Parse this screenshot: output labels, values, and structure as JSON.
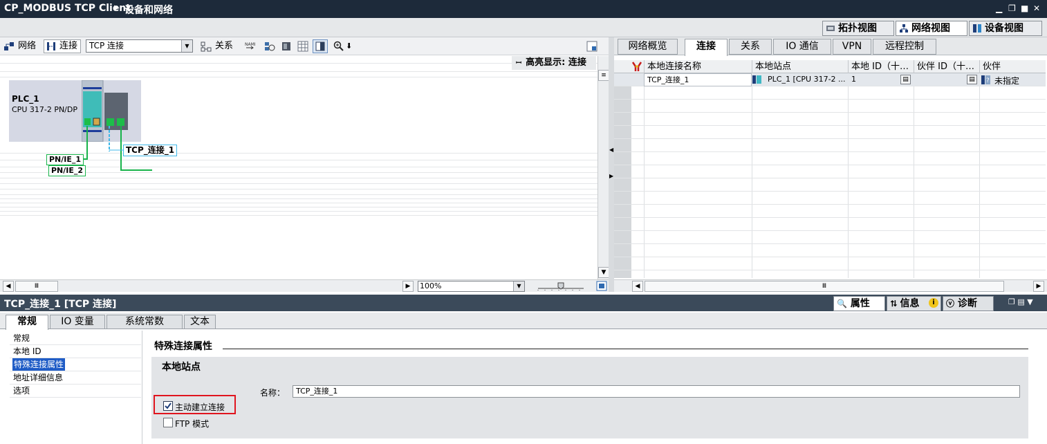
{
  "titlebar": {
    "title": "CP_MODBUS TCP Client",
    "breadcrumb": "设备和网络",
    "win_min": "▁",
    "win_restore": "❐",
    "win_close": "✕"
  },
  "views": {
    "topology": "拓扑视图",
    "network": "网络视图",
    "device": "设备视图"
  },
  "toolbar": {
    "network": "网络",
    "connections": "连接",
    "conn_type": "TCP 连接",
    "relations": "关系"
  },
  "canvas": {
    "highlight": "高亮显示: 连接",
    "plc_name": "PLC_1",
    "plc_cpu": "CPU 317-2 PN/DP",
    "tcp_label": "TCP_连接_1",
    "net1": "PN/IE_1",
    "net2": "PN/IE_2",
    "zoom": "100%",
    "scroll_grip": "Ⅲ"
  },
  "right_tabs": [
    "网络概览",
    "连接",
    "关系",
    "IO 通信",
    "VPN",
    "远程控制"
  ],
  "grid": {
    "headers": [
      "本地连接名称",
      "本地站点",
      "本地 ID（十…",
      "伙伴 ID（十…",
      "伙伴"
    ],
    "row": {
      "name": "TCP_连接_1",
      "station": "PLC_1 [CPU 317-2 ...",
      "local_id": "1",
      "partner": "未指定"
    },
    "scroll_grip": "Ⅲ"
  },
  "inspector": {
    "title": "TCP_连接_1 [TCP 连接]",
    "tabs": {
      "properties": "属性",
      "info": "信息",
      "diagnostics": "诊断"
    }
  },
  "prop_tabs": [
    "常规",
    "IO 变量",
    "系统常数",
    "文本"
  ],
  "nav": [
    "常规",
    "本地 ID",
    "特殊连接属性",
    "地址详细信息",
    "选项"
  ],
  "content": {
    "section": "特殊连接属性",
    "group": "本地站点",
    "name_label": "名称：",
    "name_value": "TCP_连接_1",
    "active_conn": "主动建立连接",
    "active_checked": true,
    "ftp_mode": "FTP 模式",
    "ftp_checked": false
  }
}
